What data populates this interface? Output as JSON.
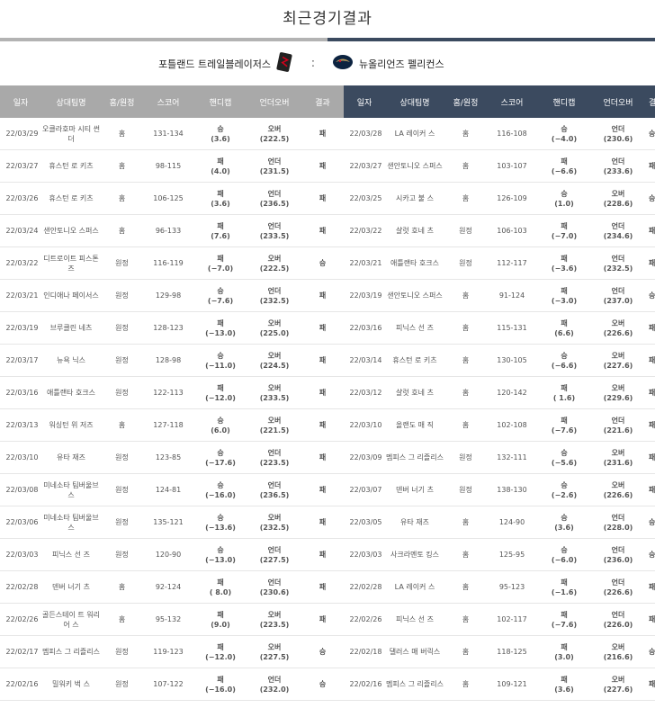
{
  "page_title": "최근경기결과",
  "matchup": {
    "home_team": "포틀랜드 트레일블레이저스",
    "separator": ":",
    "away_team": "뉴올리언즈 펠리컨스"
  },
  "headers": {
    "left": [
      "일자",
      "상대팀명",
      "홈/원정",
      "스코어",
      "핸디캡",
      "언더오버",
      "결과"
    ],
    "right": [
      "일자",
      "상대팀명",
      "홈/원정",
      "스코어",
      "핸디캡",
      "언더오버",
      "결과"
    ]
  },
  "colors": {
    "win": "#d0021b",
    "loss": "#222222",
    "under": "#1f5fbf",
    "over": "#d0021b"
  },
  "left_rows": [
    {
      "date": "22/03/29",
      "opp": "오클라호마 시티 썬더",
      "ha": "홈",
      "score": "131-134",
      "hc_res": "승",
      "hc_val": "(3.6)",
      "uo_res": "오버",
      "uo_val": "(222.5)",
      "result": "패"
    },
    {
      "date": "22/03/27",
      "opp": "휴스턴 로 키츠",
      "ha": "홈",
      "score": "98-115",
      "hc_res": "패",
      "hc_val": "(4.0)",
      "uo_res": "언더",
      "uo_val": "(231.5)",
      "result": "패"
    },
    {
      "date": "22/03/26",
      "opp": "휴스턴 로 키츠",
      "ha": "홈",
      "score": "106-125",
      "hc_res": "패",
      "hc_val": "(3.6)",
      "uo_res": "언더",
      "uo_val": "(236.5)",
      "result": "패"
    },
    {
      "date": "22/03/24",
      "opp": "샌안토니오 스퍼스",
      "ha": "홈",
      "score": "96-133",
      "hc_res": "패",
      "hc_val": "(7.6)",
      "uo_res": "언더",
      "uo_val": "(233.5)",
      "result": "패"
    },
    {
      "date": "22/03/22",
      "opp": "디트로이트 피스톤즈",
      "ha": "원정",
      "score": "116-119",
      "hc_res": "패",
      "hc_val": "(−7.0)",
      "uo_res": "오버",
      "uo_val": "(222.5)",
      "result": "승"
    },
    {
      "date": "22/03/21",
      "opp": "인디애나 페이서스",
      "ha": "원정",
      "score": "129-98",
      "hc_res": "승",
      "hc_val": "(−7.6)",
      "uo_res": "언더",
      "uo_val": "(232.5)",
      "result": "패"
    },
    {
      "date": "22/03/19",
      "opp": "브루클린 네츠",
      "ha": "원정",
      "score": "128-123",
      "hc_res": "패",
      "hc_val": "(−13.0)",
      "uo_res": "오버",
      "uo_val": "(225.0)",
      "result": "패"
    },
    {
      "date": "22/03/17",
      "opp": "뉴욕 닉스",
      "ha": "원정",
      "score": "128-98",
      "hc_res": "승",
      "hc_val": "(−11.0)",
      "uo_res": "오버",
      "uo_val": "(224.5)",
      "result": "패"
    },
    {
      "date": "22/03/16",
      "opp": "애틀랜타 호크스",
      "ha": "원정",
      "score": "122-113",
      "hc_res": "패",
      "hc_val": "(−12.0)",
      "uo_res": "오버",
      "uo_val": "(233.5)",
      "result": "패"
    },
    {
      "date": "22/03/13",
      "opp": "워싱턴 위 저즈",
      "ha": "홈",
      "score": "127-118",
      "hc_res": "승",
      "hc_val": "(6.0)",
      "uo_res": "오버",
      "uo_val": "(221.5)",
      "result": "패"
    },
    {
      "date": "22/03/10",
      "opp": "유타 재즈",
      "ha": "원정",
      "score": "123-85",
      "hc_res": "승",
      "hc_val": "(−17.6)",
      "uo_res": "언더",
      "uo_val": "(223.5)",
      "result": "패"
    },
    {
      "date": "22/03/08",
      "opp": "미네소타 팀버울브스",
      "ha": "원정",
      "score": "124-81",
      "hc_res": "승",
      "hc_val": "(−16.0)",
      "uo_res": "언더",
      "uo_val": "(236.5)",
      "result": "패"
    },
    {
      "date": "22/03/06",
      "opp": "미네소타 팀버울브스",
      "ha": "원정",
      "score": "135-121",
      "hc_res": "승",
      "hc_val": "(−13.6)",
      "uo_res": "오버",
      "uo_val": "(232.5)",
      "result": "패"
    },
    {
      "date": "22/03/03",
      "opp": "피닉스 선 즈",
      "ha": "원정",
      "score": "120-90",
      "hc_res": "승",
      "hc_val": "(−13.0)",
      "uo_res": "언더",
      "uo_val": "(227.5)",
      "result": "패"
    },
    {
      "date": "22/02/28",
      "opp": "덴버 너기 츠",
      "ha": "홈",
      "score": "92-124",
      "hc_res": "패",
      "hc_val": "( 8.0)",
      "uo_res": "언더",
      "uo_val": "(230.6)",
      "result": "패"
    },
    {
      "date": "22/02/26",
      "opp": "골든스테이 트 워리어 스",
      "ha": "홈",
      "score": "95-132",
      "hc_res": "패",
      "hc_val": "(9.0)",
      "uo_res": "오버",
      "uo_val": "(223.5)",
      "result": "패"
    },
    {
      "date": "22/02/17",
      "opp": "멤피스 그 리즐리스",
      "ha": "원정",
      "score": "119-123",
      "hc_res": "패",
      "hc_val": "(−12.0)",
      "uo_res": "오버",
      "uo_val": "(227.5)",
      "result": "승"
    },
    {
      "date": "22/02/16",
      "opp": "밀워키 벅 스",
      "ha": "원정",
      "score": "107-122",
      "hc_res": "패",
      "hc_val": "(−16.0)",
      "uo_res": "언더",
      "uo_val": "(232.0)",
      "result": "승"
    }
  ],
  "right_rows": [
    {
      "date": "22/03/28",
      "opp": "LA 레이커 스",
      "ha": "홈",
      "score": "116-108",
      "hc_res": "승",
      "hc_val": "(−4.0)",
      "uo_res": "언더",
      "uo_val": "(230.6)",
      "result": "승"
    },
    {
      "date": "22/03/27",
      "opp": "샌안토니오 스퍼스",
      "ha": "홈",
      "score": "103-107",
      "hc_res": "패",
      "hc_val": "(−6.6)",
      "uo_res": "언더",
      "uo_val": "(233.6)",
      "result": "패"
    },
    {
      "date": "22/03/25",
      "opp": "시카고 불 스",
      "ha": "홈",
      "score": "126-109",
      "hc_res": "승",
      "hc_val": "(1.0)",
      "uo_res": "오버",
      "uo_val": "(228.6)",
      "result": "승"
    },
    {
      "date": "22/03/22",
      "opp": "샬럿 호네 츠",
      "ha": "원정",
      "score": "106-103",
      "hc_res": "패",
      "hc_val": "(−7.0)",
      "uo_res": "언더",
      "uo_val": "(234.6)",
      "result": "패"
    },
    {
      "date": "22/03/21",
      "opp": "애틀랜타 호크스",
      "ha": "원정",
      "score": "112-117",
      "hc_res": "패",
      "hc_val": "(−3.6)",
      "uo_res": "언더",
      "uo_val": "(232.5)",
      "result": "패"
    },
    {
      "date": "22/03/19",
      "opp": "샌안토니오 스퍼스",
      "ha": "홈",
      "score": "91-124",
      "hc_res": "패",
      "hc_val": "(−3.0)",
      "uo_res": "언더",
      "uo_val": "(237.0)",
      "result": "승"
    },
    {
      "date": "22/03/16",
      "opp": "피닉스 선 즈",
      "ha": "홈",
      "score": "115-131",
      "hc_res": "패",
      "hc_val": "(6.6)",
      "uo_res": "오버",
      "uo_val": "(226.6)",
      "result": "패"
    },
    {
      "date": "22/03/14",
      "opp": "휴스턴 로 키츠",
      "ha": "홈",
      "score": "130-105",
      "hc_res": "승",
      "hc_val": "(−6.6)",
      "uo_res": "오버",
      "uo_val": "(227.6)",
      "result": "패"
    },
    {
      "date": "22/03/12",
      "opp": "샬럿 호네 츠",
      "ha": "홈",
      "score": "120-142",
      "hc_res": "패",
      "hc_val": "( 1.6)",
      "uo_res": "오버",
      "uo_val": "(229.6)",
      "result": "패"
    },
    {
      "date": "22/03/10",
      "opp": "올랜도 매 직",
      "ha": "홈",
      "score": "102-108",
      "hc_res": "패",
      "hc_val": "(−7.6)",
      "uo_res": "언더",
      "uo_val": "(221.6)",
      "result": "패"
    },
    {
      "date": "22/03/09",
      "opp": "멤피스 그 리즐리스",
      "ha": "원정",
      "score": "132-111",
      "hc_res": "승",
      "hc_val": "(−5.6)",
      "uo_res": "오버",
      "uo_val": "(231.6)",
      "result": "패"
    },
    {
      "date": "22/03/07",
      "opp": "덴버 너기 츠",
      "ha": "원정",
      "score": "138-130",
      "hc_res": "승",
      "hc_val": "(−2.6)",
      "uo_res": "오버",
      "uo_val": "(226.6)",
      "result": "패"
    },
    {
      "date": "22/03/05",
      "opp": "유타 재즈",
      "ha": "홈",
      "score": "124-90",
      "hc_res": "승",
      "hc_val": "(3.6)",
      "uo_res": "언더",
      "uo_val": "(228.0)",
      "result": "승"
    },
    {
      "date": "22/03/03",
      "opp": "사크라멘토 킹스",
      "ha": "홈",
      "score": "125-95",
      "hc_res": "승",
      "hc_val": "(−6.0)",
      "uo_res": "언더",
      "uo_val": "(236.0)",
      "result": "승"
    },
    {
      "date": "22/02/28",
      "opp": "LA 레이커 스",
      "ha": "홈",
      "score": "95-123",
      "hc_res": "패",
      "hc_val": "(−1.6)",
      "uo_res": "언더",
      "uo_val": "(226.6)",
      "result": "패"
    },
    {
      "date": "22/02/26",
      "opp": "피닉스 선 즈",
      "ha": "홈",
      "score": "102-117",
      "hc_res": "패",
      "hc_val": "(−7.6)",
      "uo_res": "언더",
      "uo_val": "(226.0)",
      "result": "패"
    },
    {
      "date": "22/02/18",
      "opp": "댈러스 매 버릭스",
      "ha": "홈",
      "score": "118-125",
      "hc_res": "패",
      "hc_val": "(3.0)",
      "uo_res": "오버",
      "uo_val": "(216.6)",
      "result": "승"
    },
    {
      "date": "22/02/16",
      "opp": "멤피스 그 리즐리스",
      "ha": "홈",
      "score": "109-121",
      "hc_res": "패",
      "hc_val": "(3.6)",
      "uo_res": "오버",
      "uo_val": "(227.6)",
      "result": "패"
    }
  ]
}
